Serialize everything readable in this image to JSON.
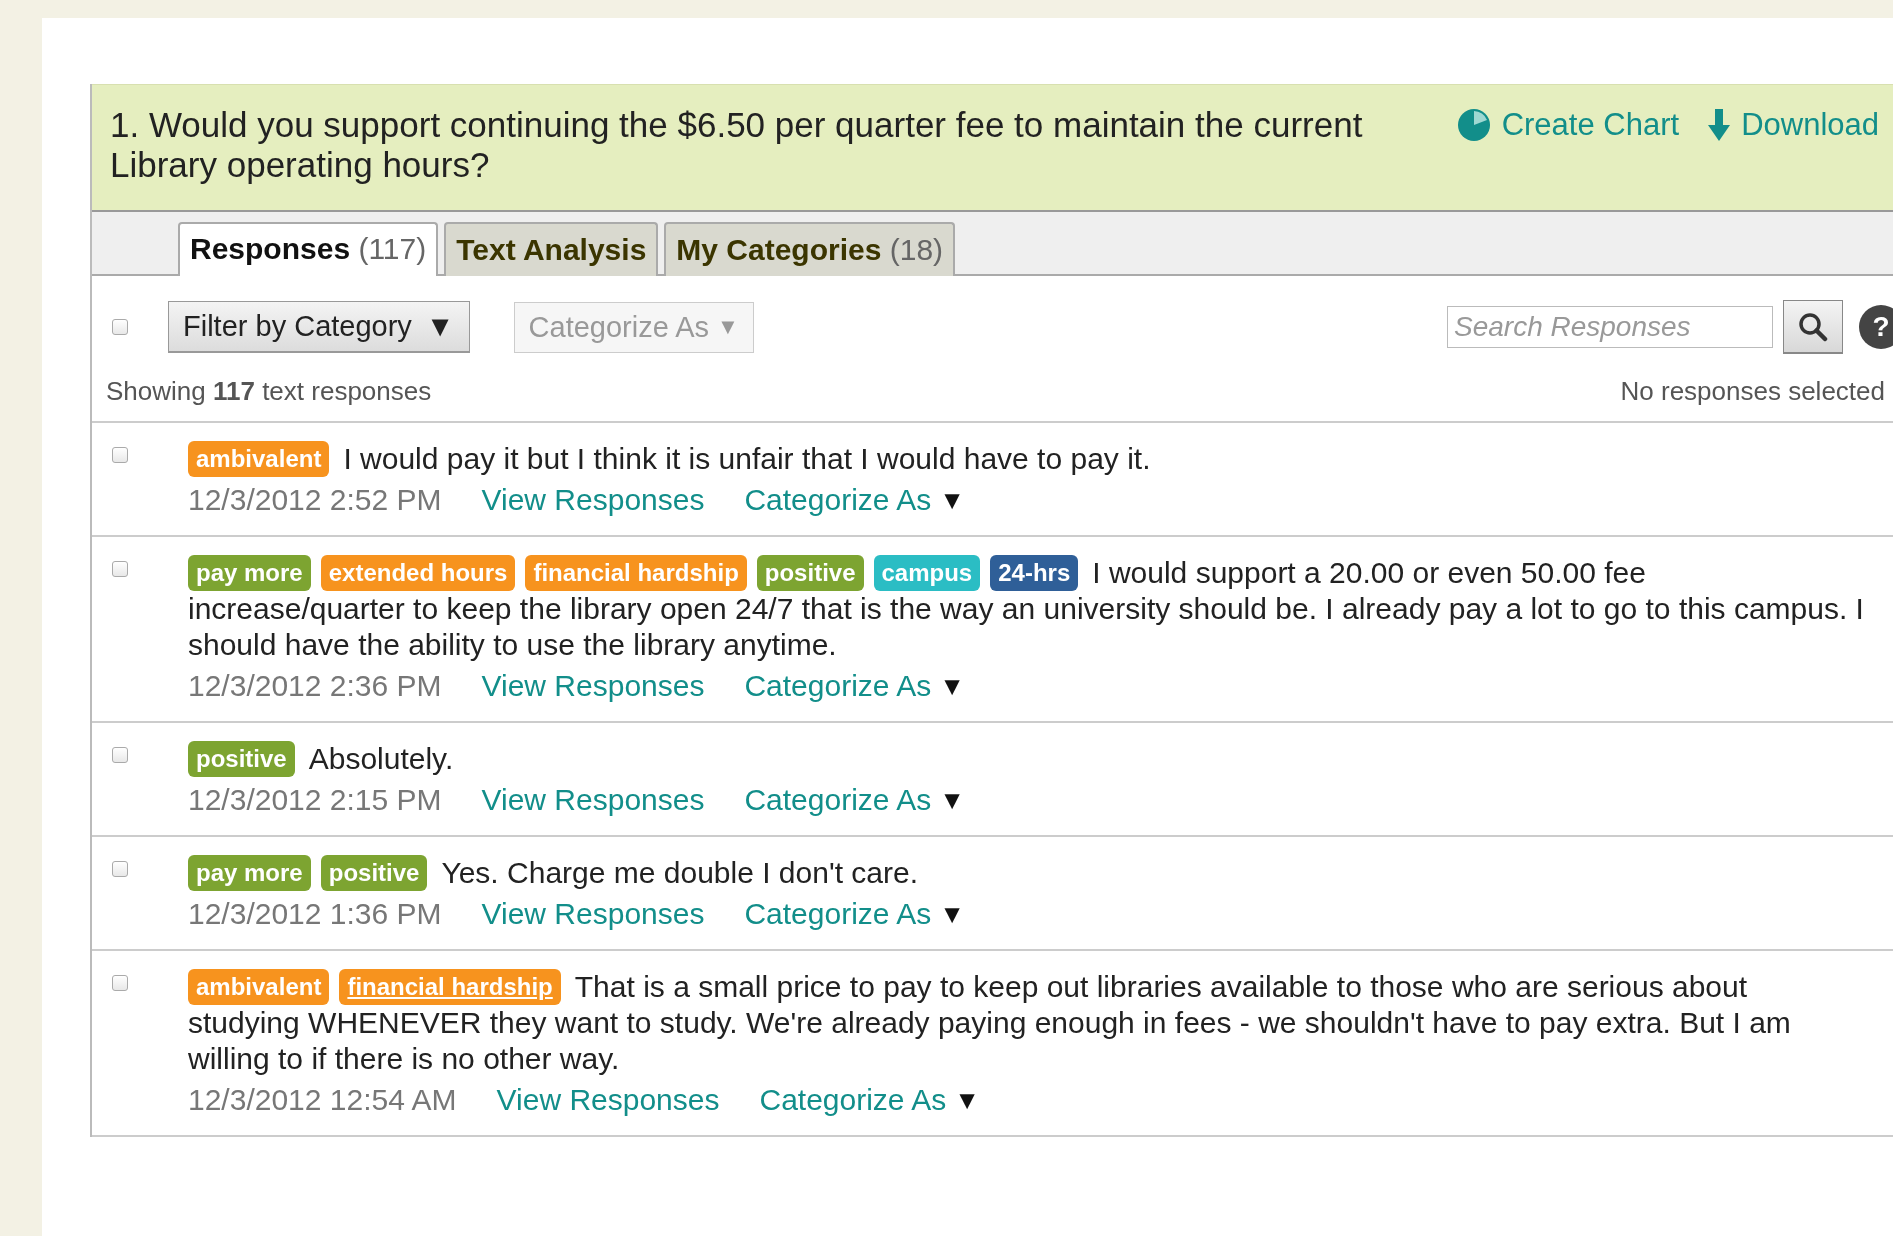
{
  "question": {
    "text": "1. Would you support continuing the $6.50 per quarter fee to maintain the current Library operating hours?"
  },
  "actions": [
    {
      "kind": "chart",
      "label": "Create Chart"
    },
    {
      "kind": "download",
      "label": "Download"
    }
  ],
  "tabs": [
    {
      "label": "Responses",
      "count": "(117)",
      "selected": true
    },
    {
      "label": "Text Analysis",
      "selected": false
    },
    {
      "label": "My Categories",
      "count": "(18)",
      "selected": false
    }
  ],
  "toolbar": {
    "select_all_checked": false,
    "filter_label": "Filter by Category",
    "filter_caret": "▼",
    "categorize_label": "Categorize As",
    "categorize_caret": "▼",
    "categorize_disabled": true,
    "search": {
      "placeholder": "Search Responses"
    },
    "help": "?"
  },
  "summary": {
    "text": "Showing **117** text responses",
    "selection": "No responses selected"
  },
  "responses": [
    {
      "checked": false,
      "tags": [
        {
          "label": "ambivalent",
          "color": "#f7931e",
          "hovered": false
        }
      ],
      "text": "I would pay it but I think it is unfair that I would have to pay it.",
      "date": "12/3/2012 2:52 PM",
      "view": "View Responses",
      "categorize": "Categorize As",
      "caret": "▼"
    },
    {
      "checked": false,
      "tags": [
        {
          "label": "pay more",
          "color": "#7da431",
          "hovered": false
        },
        {
          "label": "extended hours",
          "color": "#f7931e",
          "hovered": false
        },
        {
          "label": "financial hardship",
          "color": "#f7931e",
          "hovered": false
        },
        {
          "label": "positive",
          "color": "#7da431",
          "hovered": false
        },
        {
          "label": "campus",
          "color": "#2bbdc4",
          "hovered": false
        },
        {
          "label": "24-hrs",
          "color": "#2f5f98",
          "hovered": false
        }
      ],
      "text": "I would support a 20.00 or even 50.00 fee",
      "more_lines": [
        "increase/quarter to keep the library open 24/7 that is the way an university should be. I already pay a lot to go to this campus. I",
        "should have the ability to use the library anytime."
      ],
      "date": "12/3/2012 2:36 PM",
      "view": "View Responses",
      "categorize": "Categorize As",
      "caret": "▼"
    },
    {
      "checked": false,
      "tags": [
        {
          "label": "positive",
          "color": "#7da431",
          "hovered": false
        }
      ],
      "text": "Absolutely.",
      "date": "12/3/2012 2:15 PM",
      "view": "View Responses",
      "categorize": "Categorize As",
      "caret": "▼"
    },
    {
      "checked": false,
      "tags": [
        {
          "label": "pay more",
          "color": "#7da431",
          "hovered": false
        },
        {
          "label": "positive",
          "color": "#7da431",
          "hovered": false
        }
      ],
      "text": "Yes. Charge me double I don't care.",
      "date": "12/3/2012 1:36 PM",
      "view": "View Responses",
      "categorize": "Categorize As",
      "caret": "▼"
    },
    {
      "checked": false,
      "tags": [
        {
          "label": "ambivalent",
          "color": "#f7931e",
          "hovered": false
        },
        {
          "label": "financial hardship",
          "color": "#f7931e",
          "hovered": true
        }
      ],
      "text": "That is a small price to pay to keep out libraries available to those who are serious about",
      "more_lines": [
        "studying WHENEVER they want to study. We're already paying enough in fees - we shouldn't have to pay extra. But I am",
        "willing to if there is no other way."
      ],
      "date": "12/3/2012 12:54 AM",
      "view": "View Responses",
      "categorize": "Categorize As",
      "caret": "▼"
    }
  ]
}
